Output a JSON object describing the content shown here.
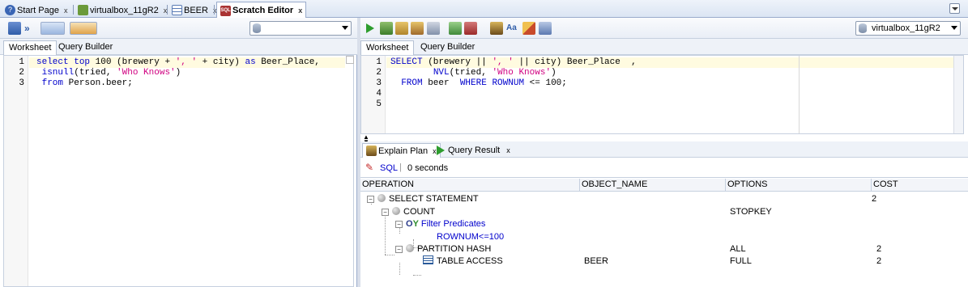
{
  "tabs": [
    {
      "label": "Start Page",
      "icon": "help-icon",
      "active": false
    },
    {
      "label": "virtualbox_11gR2",
      "icon": "connection-icon",
      "active": false
    },
    {
      "label": "BEER",
      "icon": "table-icon",
      "active": false
    },
    {
      "label": "Scratch Editor",
      "icon": "sql-icon",
      "active": true
    }
  ],
  "left_panel": {
    "subtabs": [
      "Worksheet",
      "Query Builder"
    ],
    "connection_value": "",
    "code_lines": [
      "select top 100 (brewery + ', ' + city) as Beer_Place,",
      " isnull(tried, 'Who Knows')",
      " from Person.beer;"
    ],
    "line_numbers": [
      "1",
      "2",
      "3"
    ]
  },
  "right_panel": {
    "connection_value": "virtualbox_11gR2",
    "subtabs": [
      "Worksheet",
      "Query Builder"
    ],
    "code_lines": [
      "SELECT (brewery || ', ' || city) Beer_Place  ,",
      "        NVL(tried, 'Who Knows')",
      "  FROM beer  WHERE ROWNUM <= 100;",
      "",
      ""
    ],
    "line_numbers": [
      "1",
      "2",
      "3",
      "4",
      "5"
    ]
  },
  "results": {
    "tabs": [
      "Explain Plan",
      "Query Result"
    ],
    "sql_label": "SQL",
    "timing": "0 seconds",
    "columns": [
      "OPERATION",
      "OBJECT_NAME",
      "OPTIONS",
      "COST"
    ],
    "rows": [
      {
        "operation": "SELECT STATEMENT",
        "object_name": "",
        "options": "",
        "cost": "2"
      },
      {
        "operation": "COUNT",
        "object_name": "",
        "options": "STOPKEY",
        "cost": ""
      },
      {
        "operation": "Filter Predicates",
        "object_name": "",
        "options": "",
        "cost": ""
      },
      {
        "operation": "ROWNUM<=100",
        "object_name": "",
        "options": "",
        "cost": ""
      },
      {
        "operation": "PARTITION HASH",
        "object_name": "",
        "options": "ALL",
        "cost": "2"
      },
      {
        "operation": "TABLE ACCESS",
        "object_name": "BEER",
        "options": "FULL",
        "cost": "2"
      }
    ]
  },
  "colors": {
    "tabstrip": "#dbe5f3",
    "keyword": "#0000cc",
    "string": "#d00080",
    "link": "#0000cc",
    "current_line": "#fffbe0"
  }
}
